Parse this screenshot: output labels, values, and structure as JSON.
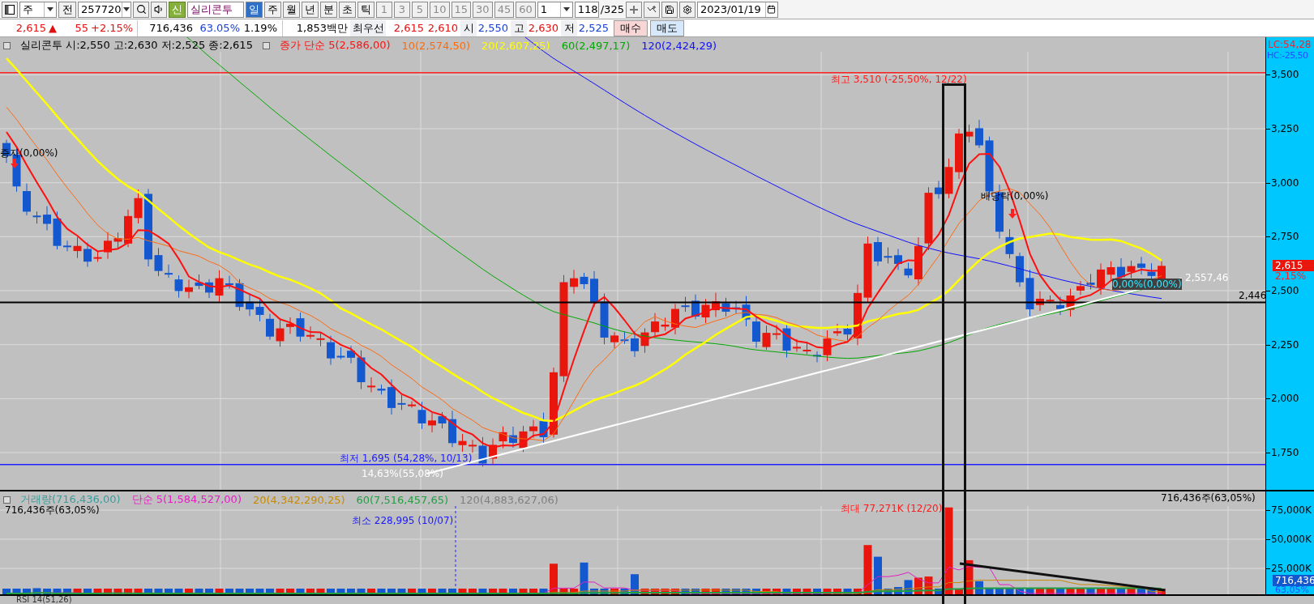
{
  "toolbar": {
    "market": "주",
    "prev": "전",
    "code": "257720",
    "badge": "신",
    "name": "실리콘투",
    "periods": [
      {
        "label": "일",
        "selected": true
      },
      {
        "label": "주",
        "selected": false
      },
      {
        "label": "월",
        "selected": false
      },
      {
        "label": "년",
        "selected": false
      },
      {
        "label": "분",
        "selected": false
      },
      {
        "label": "초",
        "selected": false
      },
      {
        "label": "틱",
        "selected": false
      }
    ],
    "intervals": [
      "1",
      "3",
      "5",
      "10",
      "15",
      "30",
      "45",
      "60"
    ],
    "count_select": "1",
    "count": "118",
    "total": "/325",
    "date": "2023/01/19"
  },
  "quote": {
    "price": "2,615",
    "arrow": "▲",
    "change": "55",
    "rate": "+2.15%",
    "volume": "716,436",
    "volume_rate": "63.05%",
    "turnover": "1.19%",
    "amount": "1,853백만",
    "best_label": "최우선",
    "best_ask": "2,615",
    "best_bid": "2,610",
    "open_label": "시",
    "open": "2,550",
    "high_label": "고",
    "high": "2,630",
    "low_label": "저",
    "low": "2,525",
    "buy": "매수",
    "sell": "매도"
  },
  "price_panel": {
    "title": "실리콘투 시:2,550 고:2,630 저:2,525 종:2,615",
    "averages": [
      {
        "label": "종가 단순 5(2,586,00)",
        "color": "#ff1010"
      },
      {
        "label": "10(2,574,50)",
        "color": "#ff6a10"
      },
      {
        "label": "20(2,607,25)",
        "color": "#ffff00"
      },
      {
        "label": "60(2,497,17)",
        "color": "#00a800"
      },
      {
        "label": "120(2,424,29)",
        "color": "#1010ff"
      }
    ],
    "annotations": [
      {
        "kind": "high",
        "text": "최고 3,510 (-25,50%, 12/22)"
      },
      {
        "kind": "low",
        "text": "최저 1,695 (54,28%, 10/13)"
      },
      {
        "kind": "event",
        "text": "증자(0,00%)"
      },
      {
        "kind": "event",
        "text": "배당락(0,00%)"
      },
      {
        "kind": "trend",
        "text": "14,63%(55,08%)"
      },
      {
        "kind": "trend",
        "text": "2,557,46"
      },
      {
        "kind": "level",
        "text": "2,446"
      },
      {
        "kind": "faint",
        "text": "0,00%(0,00%)"
      }
    ],
    "axis": {
      "lc": "LC:54,28",
      "hc": "HC:-25,50",
      "ticks": [
        "3,500",
        "3,250",
        "3,000",
        "2,750",
        "2,500",
        "2,250",
        "2,000",
        "1,750"
      ],
      "current": "2,615",
      "current_rate": "2,15%"
    }
  },
  "volume_panel": {
    "legend": [
      {
        "label": "거래량(716,436,00)",
        "color": "#3a9c9c"
      },
      {
        "label": "단순 5(1,584,527,00)",
        "color": "#e020c0"
      },
      {
        "label": "20(4,342,290,25)",
        "color": "#c88a00"
      },
      {
        "label": "60(7,516,457,65)",
        "color": "#20a040"
      },
      {
        "label": "120(4,883,627,06)",
        "color": "#808080"
      }
    ],
    "annotations": [
      {
        "kind": "info",
        "text": "716,436주(63,05%)"
      },
      {
        "kind": "info",
        "text": "716,436주(63,05%)"
      },
      {
        "kind": "high",
        "text": "최대 77,271K (12/20)"
      },
      {
        "kind": "low",
        "text": "최소 228,995 (10/07)"
      }
    ],
    "axis": {
      "ticks": [
        "75,000K",
        "50,000K",
        "25,000K"
      ],
      "current": "716,436",
      "current_rate": "63,05%"
    }
  },
  "rsi_panel": {
    "title": "RSI 14(51,26)"
  }
}
